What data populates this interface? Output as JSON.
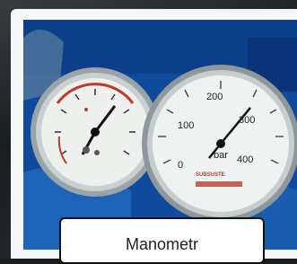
{
  "caption": {
    "text": "Manometr"
  },
  "gauge_right": {
    "unit": "bar",
    "brand": "SUBSUSTE",
    "ticks": [
      "0",
      "100",
      "200",
      "300",
      "400"
    ]
  },
  "colors": {
    "background_blue": "#0f4a9c",
    "gauge_face": "#eef3f1",
    "needle": "#111111",
    "scale_red": "#c0392b"
  }
}
